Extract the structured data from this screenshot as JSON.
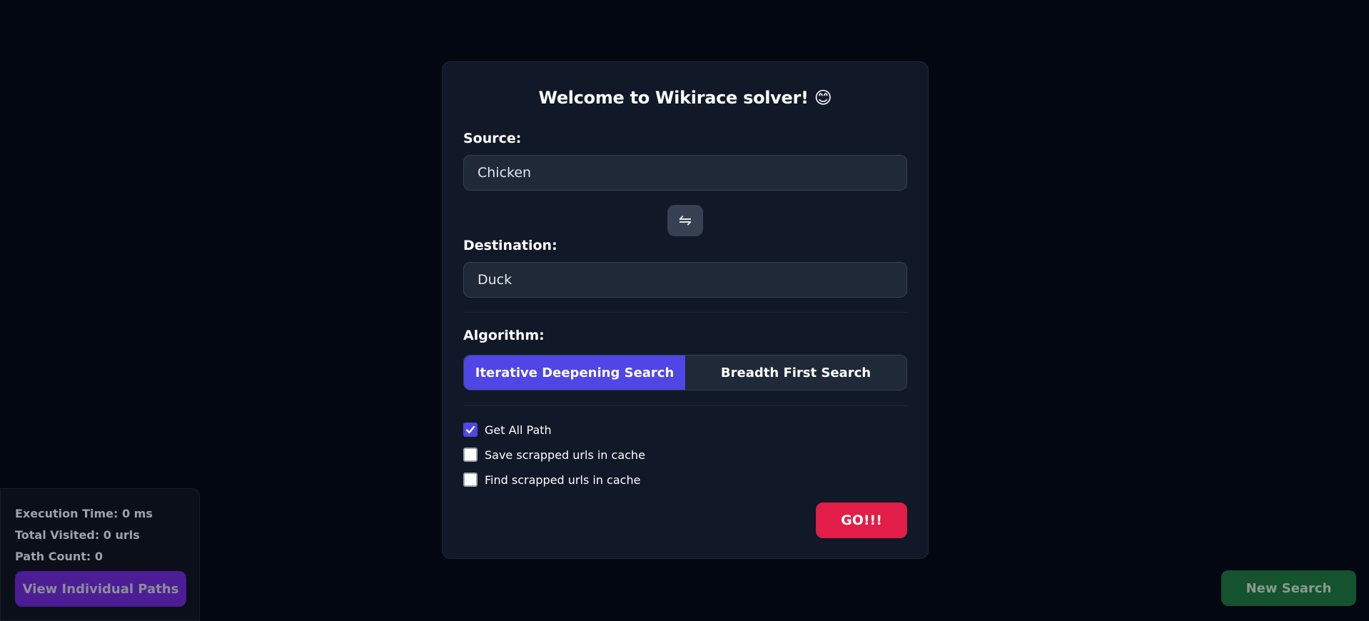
{
  "form": {
    "title": "Welcome to Wikirace solver! 😊",
    "source_label": "Source:",
    "source_value": "Chicken",
    "destination_label": "Destination:",
    "destination_value": "Duck",
    "swap_icon": "⇋",
    "algorithm_label": "Algorithm:",
    "algorithms": [
      {
        "label": "Iterative Deepening Search",
        "selected": true
      },
      {
        "label": "Breadth First Search",
        "selected": false
      }
    ],
    "options": [
      {
        "label": "Get All Path",
        "checked": true
      },
      {
        "label": "Save scrapped urls in cache",
        "checked": false
      },
      {
        "label": "Find scrapped urls in cache",
        "checked": false
      }
    ],
    "go_label": "GO!!!"
  },
  "stats": {
    "execution_time": "Execution Time: 0 ms",
    "total_visited": "Total Visited: 0 urls",
    "path_count": "Path Count: 0",
    "view_paths_label": "View Individual Paths"
  },
  "footer": {
    "new_search_label": "New Search"
  },
  "colors": {
    "background": "#030712",
    "card": "#111827",
    "accent": "#4f46e5",
    "go": "#e11d48",
    "new_search": "#14532d",
    "view_paths": "#4c1d95"
  }
}
